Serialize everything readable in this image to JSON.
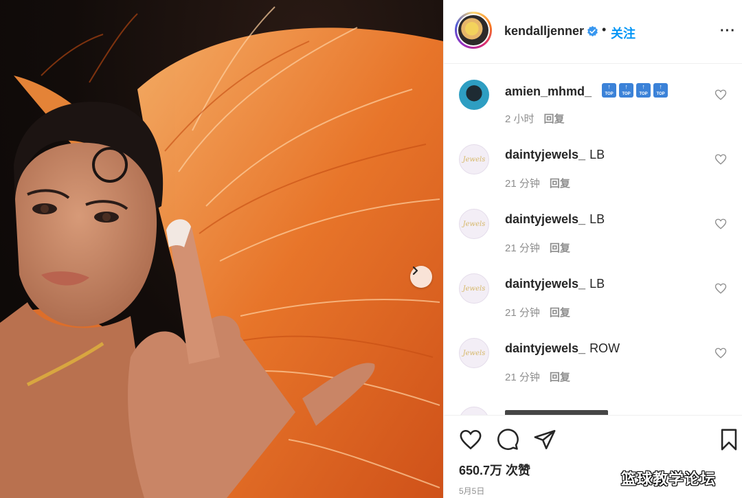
{
  "post": {
    "username": "kendalljenner",
    "follow_label": "关注",
    "dot": "•",
    "more_label": "···"
  },
  "comments": [
    {
      "user": "amien_mhmd_",
      "text": "",
      "time": "2 小时",
      "reply": "回复",
      "avatar": "amien"
    },
    {
      "user": "daintyjewels_",
      "text": "LB",
      "time": "21 分钟",
      "reply": "回复",
      "avatar": "dainty"
    },
    {
      "user": "daintyjewels_",
      "text": "LB",
      "time": "21 分钟",
      "reply": "回复",
      "avatar": "dainty"
    },
    {
      "user": "daintyjewels_",
      "text": "LB",
      "time": "21 分钟",
      "reply": "回复",
      "avatar": "dainty"
    },
    {
      "user": "daintyjewels_",
      "text": "ROW",
      "time": "21 分钟",
      "reply": "回复",
      "avatar": "dainty"
    }
  ],
  "comment_emojis": [
    "top-emoji",
    "top-emoji",
    "top-emoji",
    "top-emoji"
  ],
  "actions": {
    "likes": "650.7万 次赞",
    "date": "5月5日",
    "icons": [
      "heart-icon",
      "comment-icon",
      "share-icon",
      "bookmark-icon"
    ]
  },
  "watermark": "篮球教学论坛",
  "colors": {
    "accent_blue": "#0095f6",
    "text": "#262626",
    "muted": "#8e8e8e",
    "feather_orange": "#f07a2a"
  }
}
